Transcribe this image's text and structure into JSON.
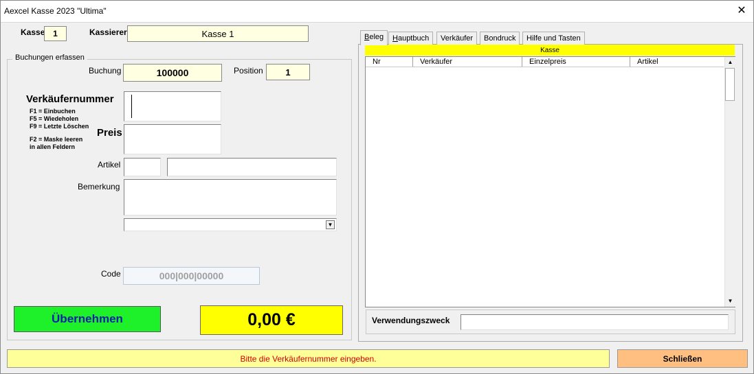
{
  "window": {
    "title": "Aexcel Kasse 2023 \"Ultima\"",
    "close_glyph": "✕"
  },
  "header": {
    "kasse_label": "Kasse",
    "kasse_value": "1",
    "kassierer_label": "Kassierer",
    "kassierer_value": "Kasse  1"
  },
  "group": {
    "legend": "Buchungen erfassen",
    "buchung_label": "Buchung",
    "buchung_value": "100000",
    "position_label": "Position",
    "position_value": "1",
    "verkaeufer_label": "Verkäufernummer",
    "hints": [
      "F1 = Einbuchen",
      "F5 = Wiedeholen",
      "F9 = Letzte Löschen"
    ],
    "hints2": [
      "F2 = Maske leeren",
      "in allen Feldern"
    ],
    "preis_label": "Preis",
    "artikel_label": "Artikel",
    "bemerkung_label": "Bemerkung",
    "code_label": "Code",
    "code_value": "000|000|00000",
    "uebernehmen_label": "Übernehmen",
    "total": "0,00 €"
  },
  "tabs": [
    {
      "label": "Beleg",
      "underline": "B",
      "rest": "eleg"
    },
    {
      "label": "Hauptbuch",
      "underline": "H",
      "rest": "auptbuch"
    },
    {
      "label": "Verkäufer"
    },
    {
      "label": "Bondruck"
    },
    {
      "label": "Hilfe und Tasten"
    }
  ],
  "beleg": {
    "title": "Kasse",
    "columns": [
      "Nr",
      "Verkäufer",
      "Einzelpreis",
      "Artikel"
    ],
    "verwendungszweck_label": "Verwendungszweck"
  },
  "status": {
    "message": "Bitte die Verkäufernummer eingeben."
  },
  "buttons": {
    "schliessen": "Schließen"
  },
  "colors": {
    "green": "#1ef02a",
    "yellow": "#ffff00",
    "orange": "#ffbf80",
    "status_text": "#d10000"
  }
}
